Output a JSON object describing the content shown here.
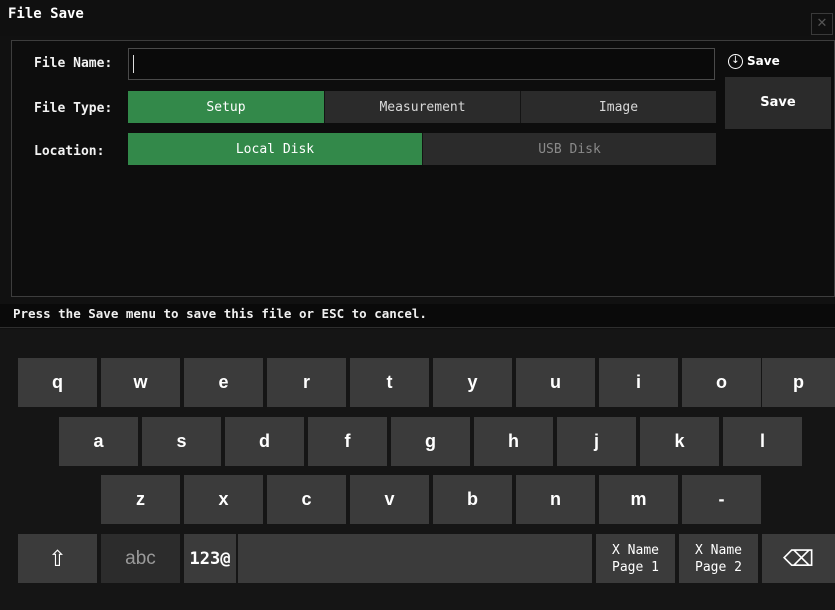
{
  "window": {
    "title": "File Save",
    "close_icon": "✕"
  },
  "form": {
    "file_name_label": "File Name:",
    "file_name_value": "",
    "file_type_label": "File Type:",
    "file_type_options": [
      "Setup",
      "Measurement",
      "Image"
    ],
    "file_type_selected": "Setup",
    "location_label": "Location:",
    "location_options": [
      "Local Disk",
      "USB Disk"
    ],
    "location_selected": "Local Disk"
  },
  "side_menu": {
    "title": "Save",
    "save_button": "Save",
    "icon": "down-arrow-circle-icon"
  },
  "status": {
    "message": "Press the Save menu to save this file or ESC to cancel."
  },
  "keyboard": {
    "row1": [
      "q",
      "w",
      "e",
      "r",
      "t",
      "y",
      "u",
      "i",
      "o",
      "p"
    ],
    "row2": [
      "a",
      "s",
      "d",
      "f",
      "g",
      "h",
      "j",
      "k",
      "l"
    ],
    "row3": [
      "z",
      "x",
      "c",
      "v",
      "b",
      "n",
      "m",
      "-"
    ],
    "shift_icon": "⇧",
    "abc": "abc",
    "num": "123@",
    "xname_page1": [
      "X Name",
      "Page 1"
    ],
    "xname_page2": [
      "X Name",
      "Page 2"
    ],
    "backspace_icon": "⌫"
  },
  "colors": {
    "accent_green": "#33894a",
    "segment_gray": "#2b2b2b",
    "key_gray": "#3b3b3b",
    "background": "#111111"
  }
}
